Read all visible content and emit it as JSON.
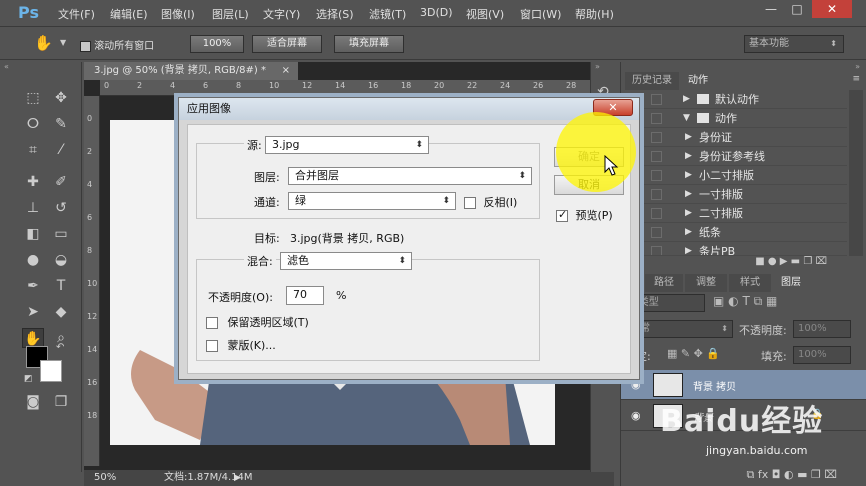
{
  "app": {
    "logo": "Ps"
  },
  "menus": [
    "文件(F)",
    "编辑(E)",
    "图像(I)",
    "图层(L)",
    "文字(Y)",
    "选择(S)",
    "滤镜(T)",
    "3D(D)",
    "视图(V)",
    "窗口(W)",
    "帮助(H)"
  ],
  "window_controls": [
    "—",
    "□",
    "✕"
  ],
  "options": {
    "scroll_all": "滚动所有窗口",
    "zoom": "100%",
    "fit_screen": "适合屏幕",
    "fill_screen": "填充屏幕",
    "workspace": "基本功能"
  },
  "document": {
    "tab": "3.jpg @ 50% (背景 拷贝, RGB/8#) *",
    "zoom": "50%",
    "doc_info": "文档:1.87M/4.14M",
    "ruler_ticks": [
      "0",
      "2",
      "4",
      "6",
      "8",
      "10",
      "12",
      "14",
      "16",
      "18",
      "20",
      "22",
      "24",
      "26",
      "28"
    ],
    "ruler_left_ticks": [
      "0",
      "2",
      "4",
      "6",
      "8",
      "10",
      "12",
      "14",
      "16",
      "18"
    ]
  },
  "panels": {
    "top_tabs": [
      "历史记录",
      "动作"
    ],
    "actions": [
      {
        "label": "默认动作",
        "kind": "folder",
        "open": false
      },
      {
        "label": "动作",
        "kind": "folder",
        "open": true
      },
      {
        "label": "身份证",
        "kind": "action"
      },
      {
        "label": "身份证参考线",
        "kind": "action"
      },
      {
        "label": "小二寸排版",
        "kind": "action"
      },
      {
        "label": "一寸排版",
        "kind": "action"
      },
      {
        "label": "二寸排版",
        "kind": "action"
      },
      {
        "label": "纸条",
        "kind": "action"
      },
      {
        "label": "条片PB",
        "kind": "action"
      }
    ],
    "layer_tabs": [
      "道",
      "路径",
      "调整",
      "样式",
      "图层"
    ],
    "kind_filter": "类型",
    "blend_mode": "正常",
    "opacity_label": "不透明度:",
    "opacity_value": "100%",
    "lock_label": "锁定:",
    "fill_label": "填充:",
    "fill_value": "100%",
    "layers": [
      {
        "name": "背景 拷贝",
        "selected": true
      },
      {
        "name": "背景",
        "selected": false
      }
    ]
  },
  "dialog": {
    "title": "应用图像",
    "close": "✕",
    "source_label": "源:",
    "source_value": "3.jpg",
    "layer_label": "图层:",
    "layer_value": "合并图层",
    "channel_label": "通道:",
    "channel_value": "绿",
    "invert_label": "反相(I)",
    "target_label": "目标:",
    "target_value": "3.jpg(背景 拷贝, RGB)",
    "blend_label": "混合:",
    "blend_value": "滤色",
    "opacity_label": "不透明度(O):",
    "opacity_value": "70",
    "opacity_unit": "%",
    "preserve_label": "保留透明区域(T)",
    "mask_label": "蒙版(K)...",
    "ok_label": "确定",
    "cancel_label": "取消",
    "preview_label": "预览(P)",
    "preview_checked": true
  },
  "watermark": {
    "brand": "Baidu经验",
    "url": "jingyan.baidu.com"
  }
}
